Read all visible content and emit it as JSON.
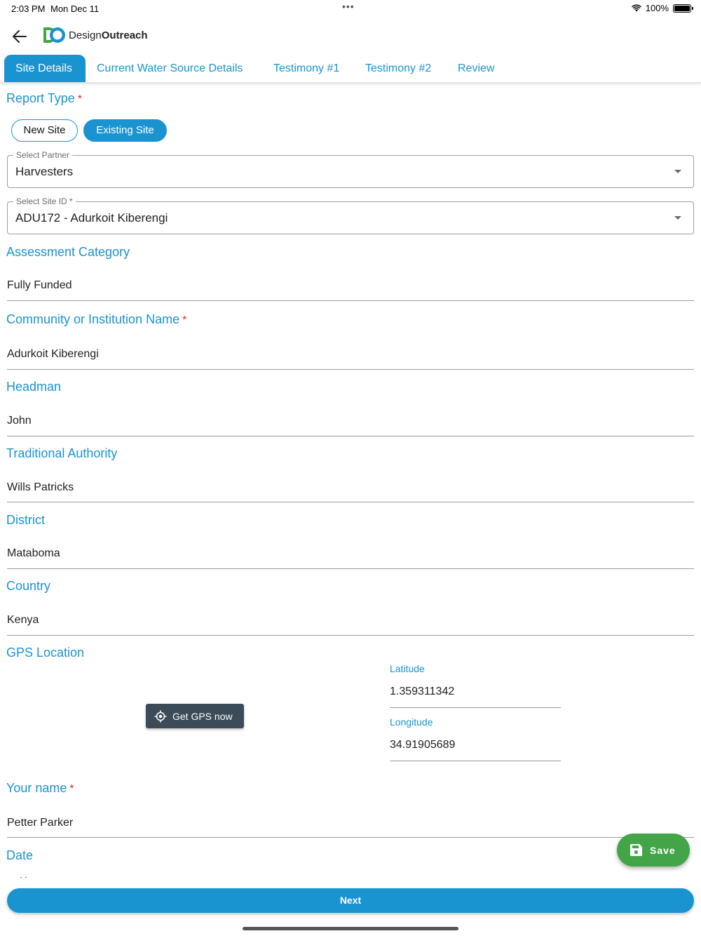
{
  "status_bar": {
    "time": "2:03 PM",
    "date": "Mon Dec 11",
    "battery": "100%"
  },
  "app": {
    "logo_prefix": "Design",
    "logo_bold": "Outreach"
  },
  "tabs": [
    {
      "label": "Site Details",
      "active": true
    },
    {
      "label": "Current Water Source Details",
      "active": false
    },
    {
      "label": "Testimony #1",
      "active": false
    },
    {
      "label": "Testimony #2",
      "active": false
    },
    {
      "label": "Review",
      "active": false
    }
  ],
  "report_type": {
    "label": "Report Type",
    "required": "*",
    "options": [
      "New Site",
      "Existing Site"
    ],
    "selected": "Existing Site"
  },
  "partner": {
    "legend": "Select Partner",
    "value": "Harvesters"
  },
  "site_id": {
    "legend": "Select Site ID *",
    "value": "ADU172 - Adurkoit Kiberengi"
  },
  "fields": {
    "assessment_category": {
      "label": "Assessment Category",
      "value": "Fully Funded"
    },
    "community_name": {
      "label": "Community or Institution Name",
      "required": "*",
      "value": "Adurkoit Kiberengi"
    },
    "headman": {
      "label": "Headman",
      "value": "John"
    },
    "traditional_authority": {
      "label": "Traditional Authority",
      "value": "Wills Patricks"
    },
    "district": {
      "label": "District",
      "value": "Mataboma"
    },
    "country": {
      "label": "Country",
      "value": "Kenya"
    },
    "your_name": {
      "label": "Your name",
      "required": "*",
      "value": "Petter Parker"
    },
    "date": {
      "label": "Date"
    }
  },
  "gps": {
    "label": "GPS Location",
    "button_label": "Get GPS now",
    "latitude_label": "Latitude",
    "latitude_value": "1.359311342",
    "longitude_label": "Longitude",
    "longitude_value": "34.91905689"
  },
  "actions": {
    "save_label": "Save",
    "next_label": "Next"
  },
  "colors": {
    "accent": "#1a93d1",
    "save": "#43a548",
    "gps_button": "#3c4b58",
    "required": "#d32f2f"
  },
  "icons": [
    "back-arrow-icon",
    "wifi-icon",
    "battery-icon",
    "gps-target-icon",
    "save-disk-icon",
    "calendar-icon"
  ]
}
